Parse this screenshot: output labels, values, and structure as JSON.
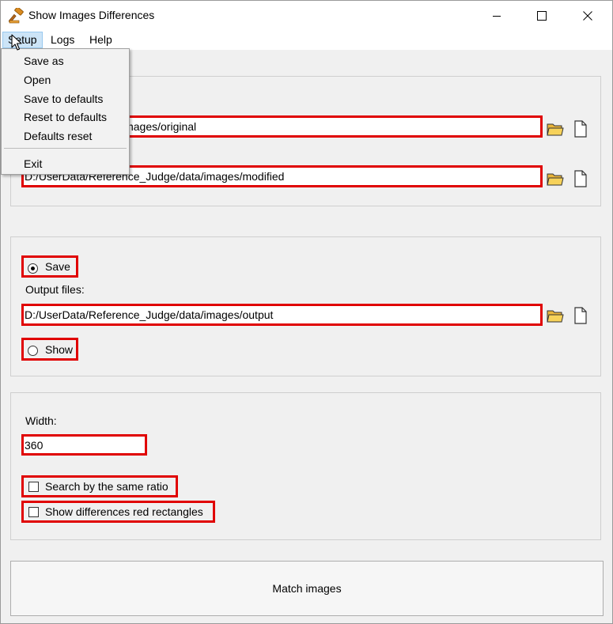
{
  "window": {
    "title": "Show Images Differences"
  },
  "menu": {
    "items": [
      "Setup",
      "Logs",
      "Help"
    ]
  },
  "setup_menu": {
    "items": [
      "Save as",
      "Open",
      "Save to defaults",
      "Reset to defaults",
      "Defaults reset"
    ],
    "exit": "Exit"
  },
  "inputs": {
    "original_path": "...ence_Judge/data/images/original",
    "modified_path": "D:/UserData/Reference_Judge/data/images/modified"
  },
  "output": {
    "save_label": "Save",
    "save_selected": true,
    "output_files_label": "Output files:",
    "output_path": "D:/UserData/Reference_Judge/data/images/output",
    "show_label": "Show",
    "show_selected": false
  },
  "options": {
    "width_label": "Width:",
    "width_value": "360",
    "same_ratio_label": "Search by the same ratio",
    "same_ratio_checked": false,
    "red_rect_label": "Show differences red rectangles",
    "red_rect_checked": false
  },
  "actions": {
    "match_label": "Match images"
  },
  "icons": {
    "app": "gavel-icon",
    "folder": "folder-open-icon",
    "file": "new-file-icon",
    "window_controls": [
      "minimize-icon",
      "maximize-icon",
      "close-icon"
    ]
  },
  "colors": {
    "highlight": "#e00000",
    "menu_active": "#cce4f7",
    "folder": "#f5c542"
  }
}
